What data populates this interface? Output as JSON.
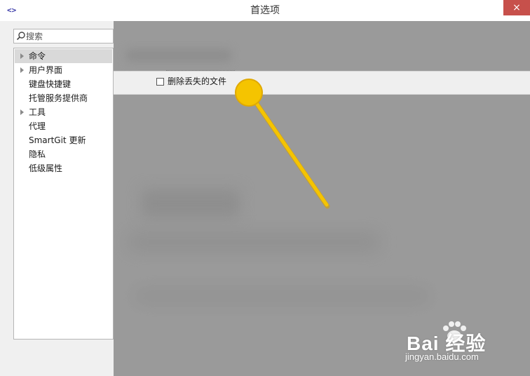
{
  "window": {
    "title": "首选项",
    "app_icon": "<>",
    "close_label": "×",
    "accent_close": "#c7504b"
  },
  "search": {
    "placeholder": "搜索",
    "icon": "search-icon"
  },
  "nav": {
    "items": [
      {
        "label": "命令",
        "expandable": true,
        "selected": true
      },
      {
        "label": "用户界面",
        "expandable": true,
        "selected": false
      },
      {
        "label": "键盘快捷键",
        "expandable": false,
        "selected": false
      },
      {
        "label": "托管服务提供商",
        "expandable": false,
        "selected": false
      },
      {
        "label": "工具",
        "expandable": true,
        "selected": false
      },
      {
        "label": "代理",
        "expandable": false,
        "selected": false
      },
      {
        "label": "SmartGit 更新",
        "expandable": false,
        "selected": false
      },
      {
        "label": "隐私",
        "expandable": false,
        "selected": false
      },
      {
        "label": "低级属性",
        "expandable": false,
        "selected": false
      }
    ]
  },
  "content": {
    "option_label": "删除丢失的文件",
    "option_checked": false
  },
  "annotation": {
    "pointer_color": "#f5c400"
  },
  "watermark": {
    "brand": "Bai 经验",
    "url": "jingyan.baidu.com"
  }
}
